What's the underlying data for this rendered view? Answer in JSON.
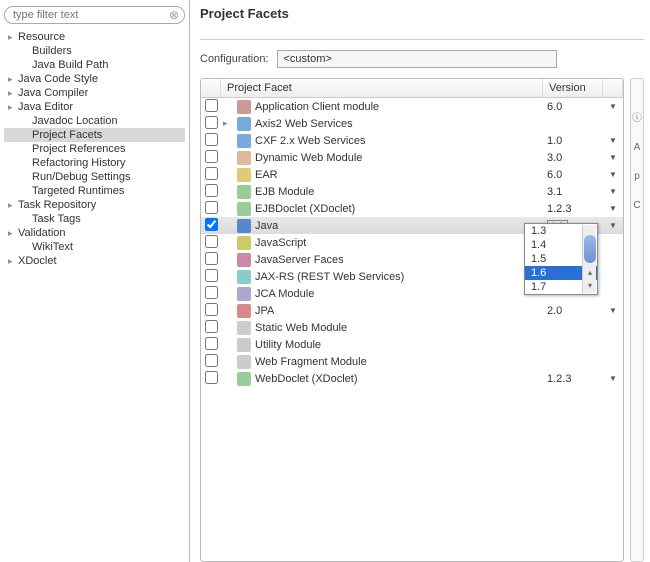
{
  "filter": {
    "placeholder": "type filter text"
  },
  "tree": [
    {
      "label": "Resource",
      "expandable": true,
      "indent": 0
    },
    {
      "label": "Builders",
      "expandable": false,
      "indent": 1
    },
    {
      "label": "Java Build Path",
      "expandable": false,
      "indent": 1
    },
    {
      "label": "Java Code Style",
      "expandable": true,
      "indent": 0
    },
    {
      "label": "Java Compiler",
      "expandable": true,
      "indent": 0
    },
    {
      "label": "Java Editor",
      "expandable": true,
      "indent": 0
    },
    {
      "label": "Javadoc Location",
      "expandable": false,
      "indent": 1
    },
    {
      "label": "Project Facets",
      "expandable": false,
      "indent": 1,
      "selected": true
    },
    {
      "label": "Project References",
      "expandable": false,
      "indent": 1
    },
    {
      "label": "Refactoring History",
      "expandable": false,
      "indent": 1
    },
    {
      "label": "Run/Debug Settings",
      "expandable": false,
      "indent": 1
    },
    {
      "label": "Targeted Runtimes",
      "expandable": false,
      "indent": 1
    },
    {
      "label": "Task Repository",
      "expandable": true,
      "indent": 0
    },
    {
      "label": "Task Tags",
      "expandable": false,
      "indent": 1
    },
    {
      "label": "Validation",
      "expandable": true,
      "indent": 0
    },
    {
      "label": "WikiText",
      "expandable": false,
      "indent": 1
    },
    {
      "label": "XDoclet",
      "expandable": true,
      "indent": 0
    }
  ],
  "title": "Project Facets",
  "config": {
    "label": "Configuration:",
    "value": "<custom>"
  },
  "headers": {
    "facet": "Project Facet",
    "version": "Version"
  },
  "facets": [
    {
      "checked": false,
      "expander": "",
      "icon": "app",
      "label": "Application Client module",
      "version": "6.0",
      "arrow": true
    },
    {
      "checked": false,
      "expander": "▸",
      "icon": "axis",
      "label": "Axis2 Web Services",
      "version": "",
      "arrow": false
    },
    {
      "checked": false,
      "expander": "",
      "icon": "cxf",
      "label": "CXF 2.x Web Services",
      "version": "1.0",
      "arrow": true
    },
    {
      "checked": false,
      "expander": "",
      "icon": "dyn",
      "label": "Dynamic Web Module",
      "version": "3.0",
      "arrow": true
    },
    {
      "checked": false,
      "expander": "",
      "icon": "ear",
      "label": "EAR",
      "version": "6.0",
      "arrow": true
    },
    {
      "checked": false,
      "expander": "",
      "icon": "ejb",
      "label": "EJB Module",
      "version": "3.1",
      "arrow": true
    },
    {
      "checked": false,
      "expander": "",
      "icon": "ejbd",
      "label": "EJBDoclet (XDoclet)",
      "version": "1.2.3",
      "arrow": true
    },
    {
      "checked": true,
      "expander": "",
      "icon": "java",
      "label": "Java",
      "version": "1.6",
      "arrow": true,
      "selected": true,
      "boxed": true
    },
    {
      "checked": false,
      "expander": "",
      "icon": "js",
      "label": "JavaScript",
      "version": "",
      "arrow": false
    },
    {
      "checked": false,
      "expander": "",
      "icon": "jsf",
      "label": "JavaServer Faces",
      "version": "",
      "arrow": false
    },
    {
      "checked": false,
      "expander": "",
      "icon": "jax",
      "label": "JAX-RS (REST Web Services)",
      "version": "",
      "arrow": false
    },
    {
      "checked": false,
      "expander": "",
      "icon": "jca",
      "label": "JCA Module",
      "version": "",
      "arrow": false
    },
    {
      "checked": false,
      "expander": "",
      "icon": "jpa",
      "label": "JPA",
      "version": "2.0",
      "arrow": true
    },
    {
      "checked": false,
      "expander": "",
      "icon": "sw",
      "label": "Static Web Module",
      "version": "",
      "arrow": false
    },
    {
      "checked": false,
      "expander": "",
      "icon": "um",
      "label": "Utility Module",
      "version": "",
      "arrow": false
    },
    {
      "checked": false,
      "expander": "",
      "icon": "wf",
      "label": "Web Fragment Module",
      "version": "",
      "arrow": false
    },
    {
      "checked": false,
      "expander": "",
      "icon": "wd",
      "label": "WebDoclet (XDoclet)",
      "version": "1.2.3",
      "arrow": true
    }
  ],
  "dropdown": {
    "options": [
      "1.3",
      "1.4",
      "1.5",
      "1.6",
      "1.7"
    ],
    "selected": "1.6"
  },
  "sidepanel": {
    "i": "ⓘ",
    "a": "A",
    "p": "p",
    "c": "C"
  }
}
